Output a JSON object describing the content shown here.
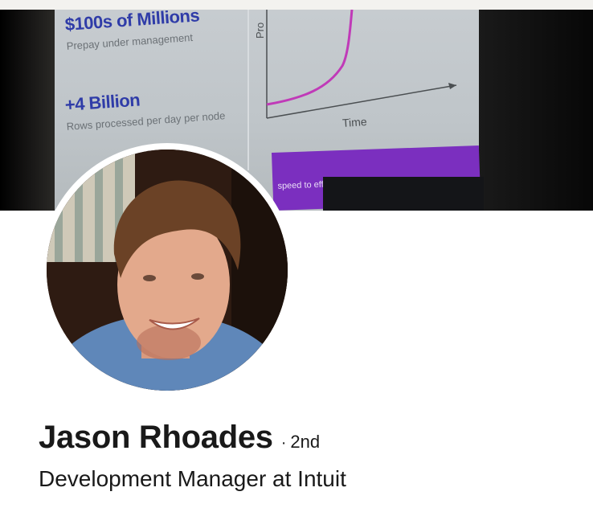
{
  "cover": {
    "slide": {
      "stats": [
        {
          "value": "$100s of Millions",
          "caption": "Prepay under management"
        },
        {
          "value": "+4 Billion",
          "caption": "Rows processed per day per node"
        }
      ],
      "chart": {
        "y_axis_label": "Pro",
        "x_axis_label": "Time"
      },
      "banner_text": "speed to effici"
    },
    "colors": {
      "stat_value": "#2f3ca8",
      "curve": "#c03ab8",
      "banner": "#7b2fbf"
    }
  },
  "profile": {
    "name": "Jason Rhoades",
    "degree_separator": "·",
    "degree": "2nd",
    "headline": "Development Manager at Intuit"
  }
}
